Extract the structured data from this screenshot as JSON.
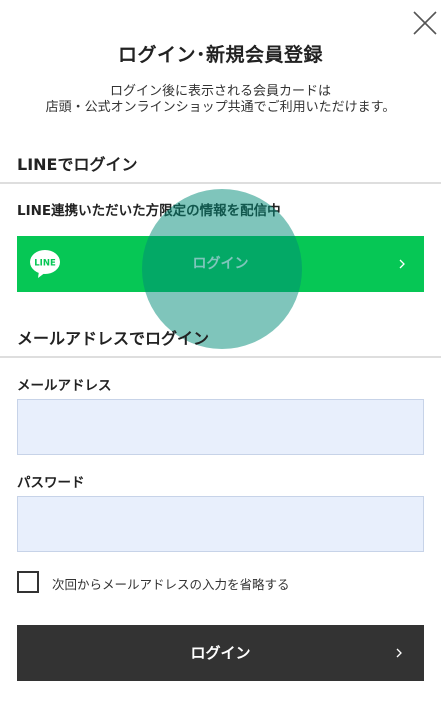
{
  "header": {
    "close_icon": "close-icon",
    "title": "ログイン･新規会員登録",
    "subtitle_line1": "ログイン後に表示される会員カードは",
    "subtitle_line2": "店頭・公式オンラインショップ共通でご利用いただけます。"
  },
  "line_section": {
    "heading": "LINEでログイン",
    "notice": "LINE連携いただいた方限定の情報を配信中",
    "button_label": "ログイン",
    "logo_text": "LINE",
    "logo_icon": "line-logo-icon",
    "chevron_icon": "chevron-right-icon",
    "brand_color": "#06c755"
  },
  "email_section": {
    "heading": "メールアドレスでログイン",
    "email_label": "メールアドレス",
    "email_value": "",
    "password_label": "パスワード",
    "password_value": "",
    "remember_checked": false,
    "remember_label": "次回からメールアドレスの入力を省略する",
    "submit_label": "ログイン",
    "submit_color": "#333333",
    "input_bg": "#e8effc"
  }
}
